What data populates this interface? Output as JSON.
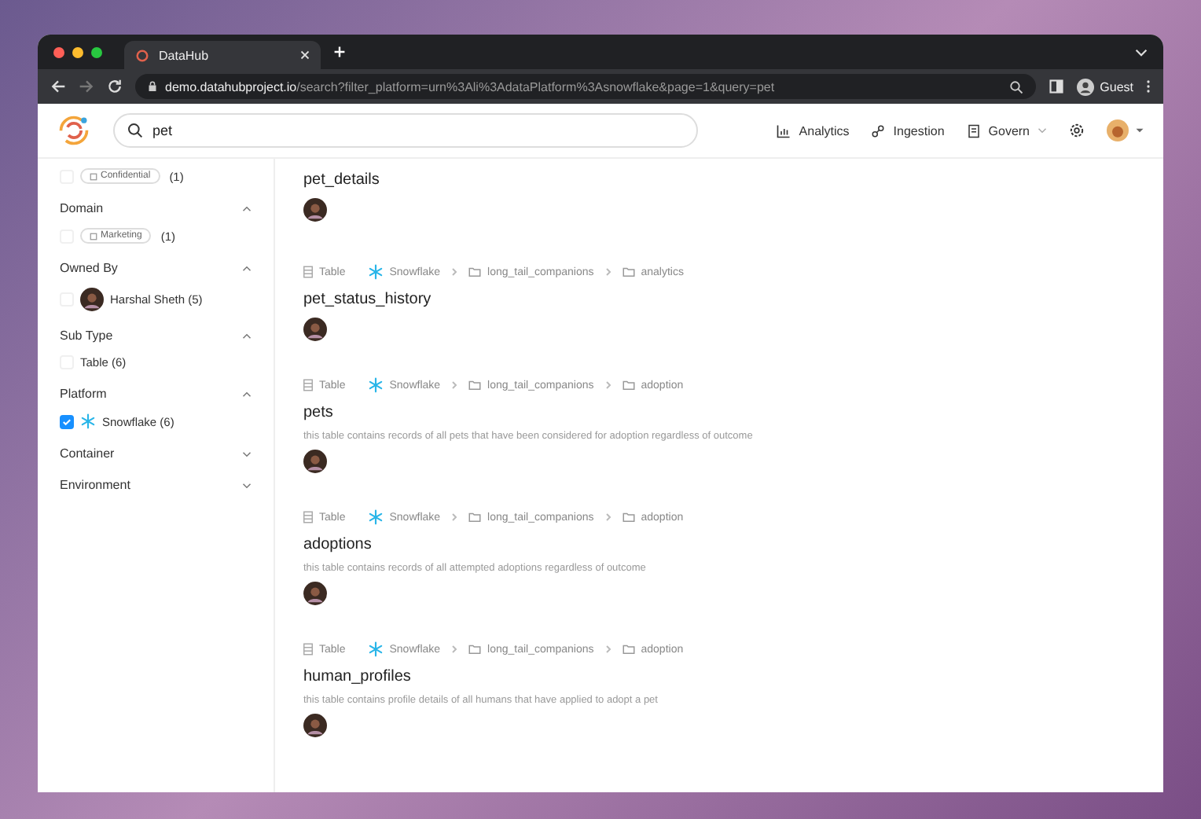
{
  "browser": {
    "tab_title": "DataHub",
    "url_host": "demo.datahubproject.io",
    "url_path": "/search?filter_platform=urn%3Ali%3AdataPlatform%3Asnowflake&page=1&query=pet",
    "profile": "Guest"
  },
  "header": {
    "search_value": "pet",
    "nav": [
      {
        "label": "Analytics",
        "kind": "analytics",
        "dropdown": false
      },
      {
        "label": "Ingestion",
        "kind": "ingestion",
        "dropdown": false
      },
      {
        "label": "Govern",
        "kind": "govern",
        "dropdown": true
      }
    ]
  },
  "filters": [
    {
      "items": [
        {
          "kind": "tag",
          "label": "Confidential",
          "count": "(1)",
          "checked": false
        }
      ]
    },
    {
      "title": "Domain",
      "expanded": true,
      "items": [
        {
          "kind": "domain",
          "label": "Marketing",
          "count": "(1)",
          "checked": false
        }
      ]
    },
    {
      "title": "Owned By",
      "expanded": true,
      "items": [
        {
          "kind": "owner",
          "label": "Harshal Sheth (5)",
          "checked": false
        }
      ]
    },
    {
      "title": "Sub Type",
      "expanded": true,
      "items": [
        {
          "kind": "plain",
          "label": "Table (6)",
          "checked": false
        }
      ]
    },
    {
      "title": "Platform",
      "expanded": true,
      "items": [
        {
          "kind": "platform",
          "label": "Snowflake (6)",
          "checked": true
        }
      ]
    },
    {
      "title": "Container",
      "expanded": false
    },
    {
      "title": "Environment",
      "expanded": false
    }
  ],
  "results": [
    {
      "name": "pet_details"
    },
    {
      "breadcrumb": {
        "type": "Table",
        "platform": "Snowflake",
        "containers": [
          "long_tail_companions",
          "analytics"
        ]
      },
      "name": "pet_status_history"
    },
    {
      "breadcrumb": {
        "type": "Table",
        "platform": "Snowflake",
        "containers": [
          "long_tail_companions",
          "adoption"
        ]
      },
      "name": "pets",
      "description": "this table contains records of all pets that have been considered for adoption regardless of outcome"
    },
    {
      "breadcrumb": {
        "type": "Table",
        "platform": "Snowflake",
        "containers": [
          "long_tail_companions",
          "adoption"
        ]
      },
      "name": "adoptions",
      "description": "this table contains records of all attempted adoptions regardless of outcome"
    },
    {
      "breadcrumb": {
        "type": "Table",
        "platform": "Snowflake",
        "containers": [
          "long_tail_companions",
          "adoption"
        ]
      },
      "name": "human_profiles",
      "description": "this table contains profile details of all humans that have applied to adopt a pet"
    }
  ]
}
